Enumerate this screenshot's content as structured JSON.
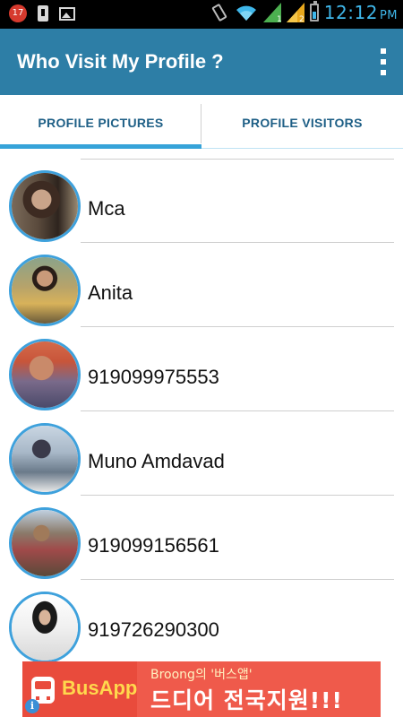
{
  "status_bar": {
    "notification_count": "17",
    "time": "12:12",
    "ampm": "PM",
    "icons": [
      "notification-badge-icon",
      "sim-card-icon",
      "image-icon",
      "vibrate-icon",
      "wifi-icon",
      "signal-1-icon",
      "signal-2-icon",
      "battery-icon"
    ]
  },
  "app_bar": {
    "title": "Who Visit My Profile ?",
    "overflow_icon": "more-vertical-icon",
    "background_color": "#2d7ea6"
  },
  "tabs": [
    {
      "label": "PROFILE PICTURES",
      "selected": true
    },
    {
      "label": "PROFILE VISITORS",
      "selected": false
    }
  ],
  "list": {
    "items": [
      {
        "name": ""
      },
      {
        "name": "Mca"
      },
      {
        "name": "Anita"
      },
      {
        "name": "919099975553"
      },
      {
        "name": "Muno Amdavad"
      },
      {
        "name": "919099156561"
      },
      {
        "name": "919726290300"
      }
    ]
  },
  "ad": {
    "brand": "BusApp",
    "tagline": "Broong의 '버스앱'",
    "headline": "드디어 전국지원!!!",
    "info_icon": "i",
    "background_color": "#ef5a4b"
  },
  "colors": {
    "accent": "#36a3d9",
    "avatar_ring": "#3ea1dc",
    "tab_text": "#1e5f86"
  }
}
